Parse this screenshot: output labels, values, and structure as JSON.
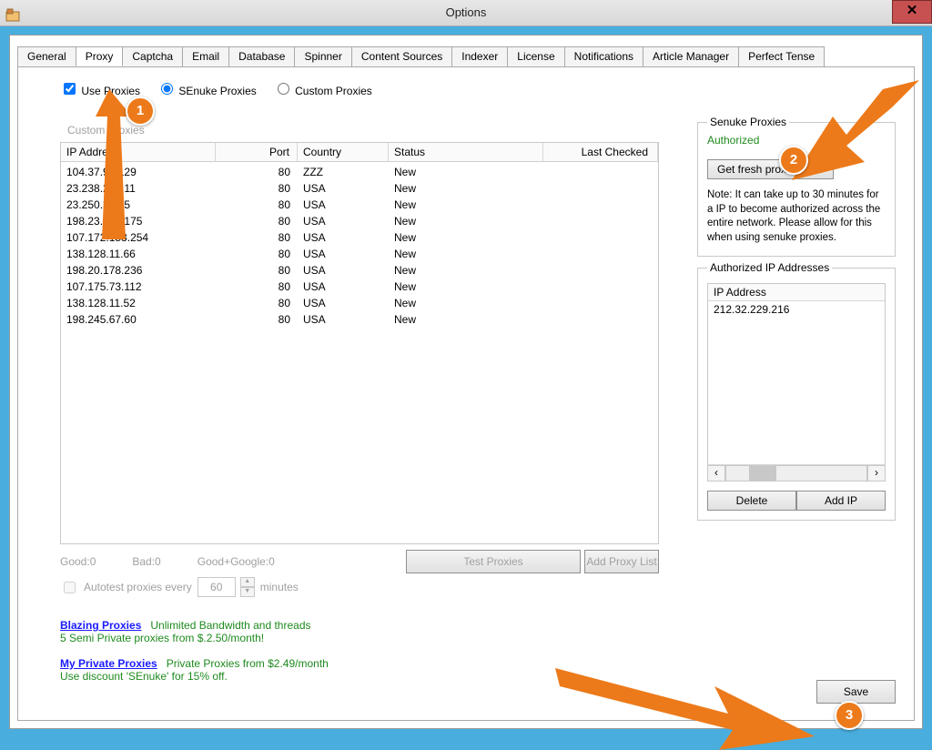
{
  "window": {
    "title": "Options"
  },
  "tabs": [
    "General",
    "Proxy",
    "Captcha",
    "Email",
    "Database",
    "Spinner",
    "Content Sources",
    "Indexer",
    "License",
    "Notifications",
    "Article Manager",
    "Perfect Tense"
  ],
  "active_tab": 1,
  "proxy": {
    "use_proxies_label": "Use Proxies",
    "use_proxies_checked": true,
    "radio_senuke": "SEnuke Proxies",
    "radio_custom": "Custom Proxies",
    "radio_selected": "senuke",
    "group_label": "Custom Proxies",
    "columns": {
      "ip": "IP Address",
      "port": "Port",
      "country": "Country",
      "status": "Status",
      "last": "Last Checked"
    },
    "rows": [
      {
        "ip": "104.37.92.129",
        "port": "80",
        "country": "ZZZ",
        "status": "New",
        "last": ""
      },
      {
        "ip": "23.238.214.11",
        "port": "80",
        "country": "USA",
        "status": "New",
        "last": ""
      },
      {
        "ip": "23.250.37.35",
        "port": "80",
        "country": "USA",
        "status": "New",
        "last": ""
      },
      {
        "ip": "198.23.174.175",
        "port": "80",
        "country": "USA",
        "status": "New",
        "last": ""
      },
      {
        "ip": "107.172.153.254",
        "port": "80",
        "country": "USA",
        "status": "New",
        "last": ""
      },
      {
        "ip": "138.128.11.66",
        "port": "80",
        "country": "USA",
        "status": "New",
        "last": ""
      },
      {
        "ip": "198.20.178.236",
        "port": "80",
        "country": "USA",
        "status": "New",
        "last": ""
      },
      {
        "ip": "107.175.73.112",
        "port": "80",
        "country": "USA",
        "status": "New",
        "last": ""
      },
      {
        "ip": "138.128.11.52",
        "port": "80",
        "country": "USA",
        "status": "New",
        "last": ""
      },
      {
        "ip": "198.245.67.60",
        "port": "80",
        "country": "USA",
        "status": "New",
        "last": ""
      }
    ],
    "stats": {
      "good": "Good:0",
      "bad": "Bad:0",
      "gg": "Good+Google:0"
    },
    "test_btn": "Test Proxies",
    "addlist_btn": "Add Proxy List",
    "autotest_label": "Autotest proxies every",
    "autotest_value": "60",
    "autotest_unit": "minutes"
  },
  "right": {
    "box_title": "Senuke Proxies",
    "authorized": "Authorized",
    "get_fresh": "Get fresh proxies now",
    "note": "Note: It can take up to 30 minutes for a IP to become authorized across the entire network. Please allow for this when using senuke proxies.",
    "auth_title": "Authorized IP Addresses",
    "ip_header": "IP Address",
    "ips": [
      "212.32.229.216"
    ],
    "delete": "Delete",
    "addip": "Add IP"
  },
  "promo": {
    "link1": "Blazing Proxies",
    "text1a": "Unlimited Bandwidth and threads",
    "text1b": "5 Semi Private proxies from $.2.50/month!",
    "link2": "My Private Proxies",
    "text2a": "Private Proxies from $2.49/month",
    "text2b": "Use discount 'SEnuke' for 15% off."
  },
  "save": "Save",
  "callouts": {
    "c1": "1",
    "c2": "2",
    "c3": "3"
  }
}
